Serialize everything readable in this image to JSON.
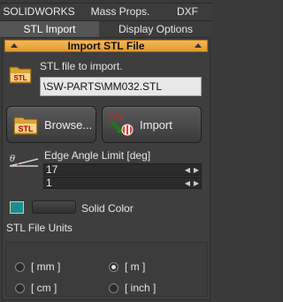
{
  "tabs": {
    "row1": [
      {
        "label": "SOLIDWORKS"
      },
      {
        "label": "Mass Props."
      },
      {
        "label": "DXF"
      }
    ],
    "row2": [
      {
        "label": "STL Import",
        "active": true
      },
      {
        "label": "Display Options",
        "active": false
      }
    ]
  },
  "section": {
    "title": "Import STL File"
  },
  "file": {
    "label": "STL file to import.",
    "path": "\\SW-PARTS\\MM032.STL",
    "icon": "stl-file-icon"
  },
  "buttons": {
    "browse": {
      "label": "Browse...",
      "icon": "stl-folder-icon"
    },
    "import": {
      "label": "Import",
      "icon": "stl-import-icon"
    }
  },
  "edge_angle": {
    "label": "Edge Angle Limit [deg]",
    "value1": "17",
    "value2": "1",
    "icon": "angle-icon"
  },
  "color": {
    "label": "Solid Color",
    "swatch": "#1a8f8f"
  },
  "units": {
    "label": "STL File Units",
    "options": [
      {
        "label": "[ mm ]",
        "selected": false
      },
      {
        "label": "[ m ]",
        "selected": true
      },
      {
        "label": "[ cm ]",
        "selected": false
      },
      {
        "label": "[ inch ]",
        "selected": false
      }
    ]
  },
  "colors": {
    "header_bar": "#e8a43c",
    "accent_teal": "#1a8f8f"
  }
}
